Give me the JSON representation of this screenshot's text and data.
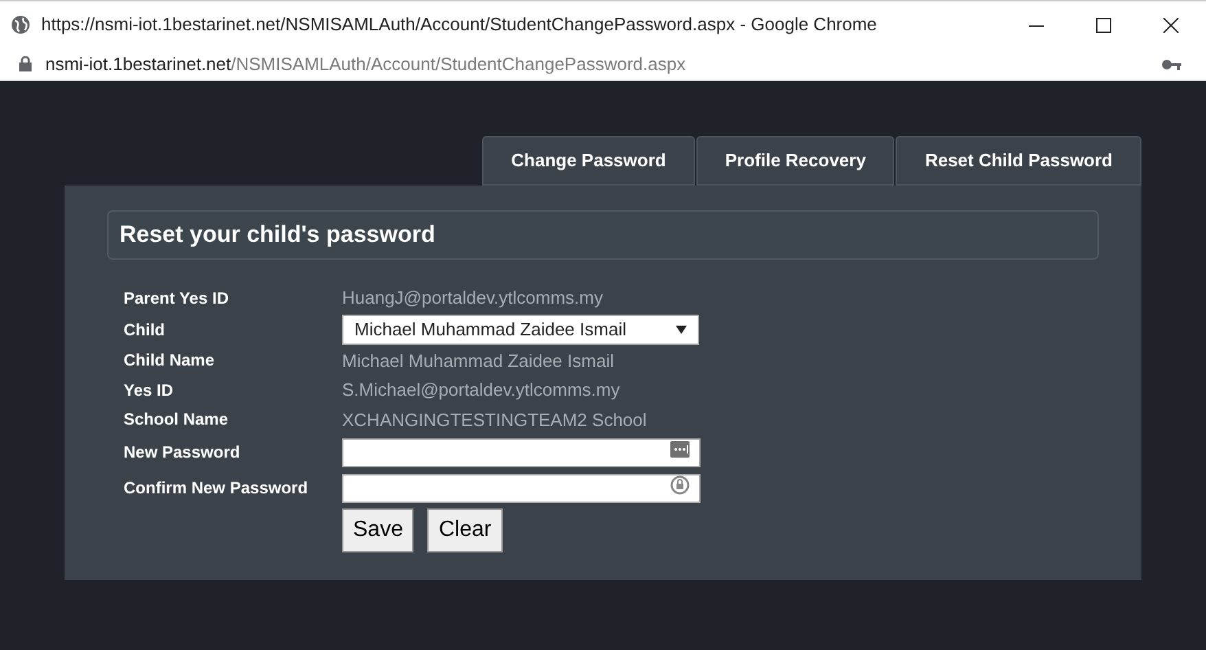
{
  "window": {
    "title": "https://nsmi-iot.1bestarinet.net/NSMISAMLAuth/Account/StudentChangePassword.aspx - Google Chrome"
  },
  "address_bar": {
    "domain": "nsmi-iot.1bestarinet.net",
    "path": "/NSMISAMLAuth/Account/StudentChangePassword.aspx"
  },
  "tabs": [
    {
      "label": "Change Password"
    },
    {
      "label": "Profile Recovery"
    },
    {
      "label": "Reset Child Password"
    }
  ],
  "form": {
    "heading": "Reset your child's password",
    "rows": [
      {
        "kind": "text",
        "label": "Parent Yes ID",
        "value": "HuangJ@portaldev.ytlcomms.my"
      },
      {
        "kind": "select",
        "label": "Child",
        "value": "Michael Muhammad Zaidee Ismail"
      },
      {
        "kind": "text",
        "label": "Child Name",
        "value": "Michael Muhammad Zaidee Ismail"
      },
      {
        "kind": "text",
        "label": "Yes ID",
        "value": "S.Michael@portaldev.ytlcomms.my"
      },
      {
        "kind": "text",
        "label": "School Name",
        "value": "XCHANGINGTESTINGTEAM2 School"
      },
      {
        "kind": "password",
        "label": "New Password"
      },
      {
        "kind": "password",
        "label": "Confirm New Password"
      }
    ],
    "buttons": [
      "Save",
      "Clear"
    ]
  }
}
